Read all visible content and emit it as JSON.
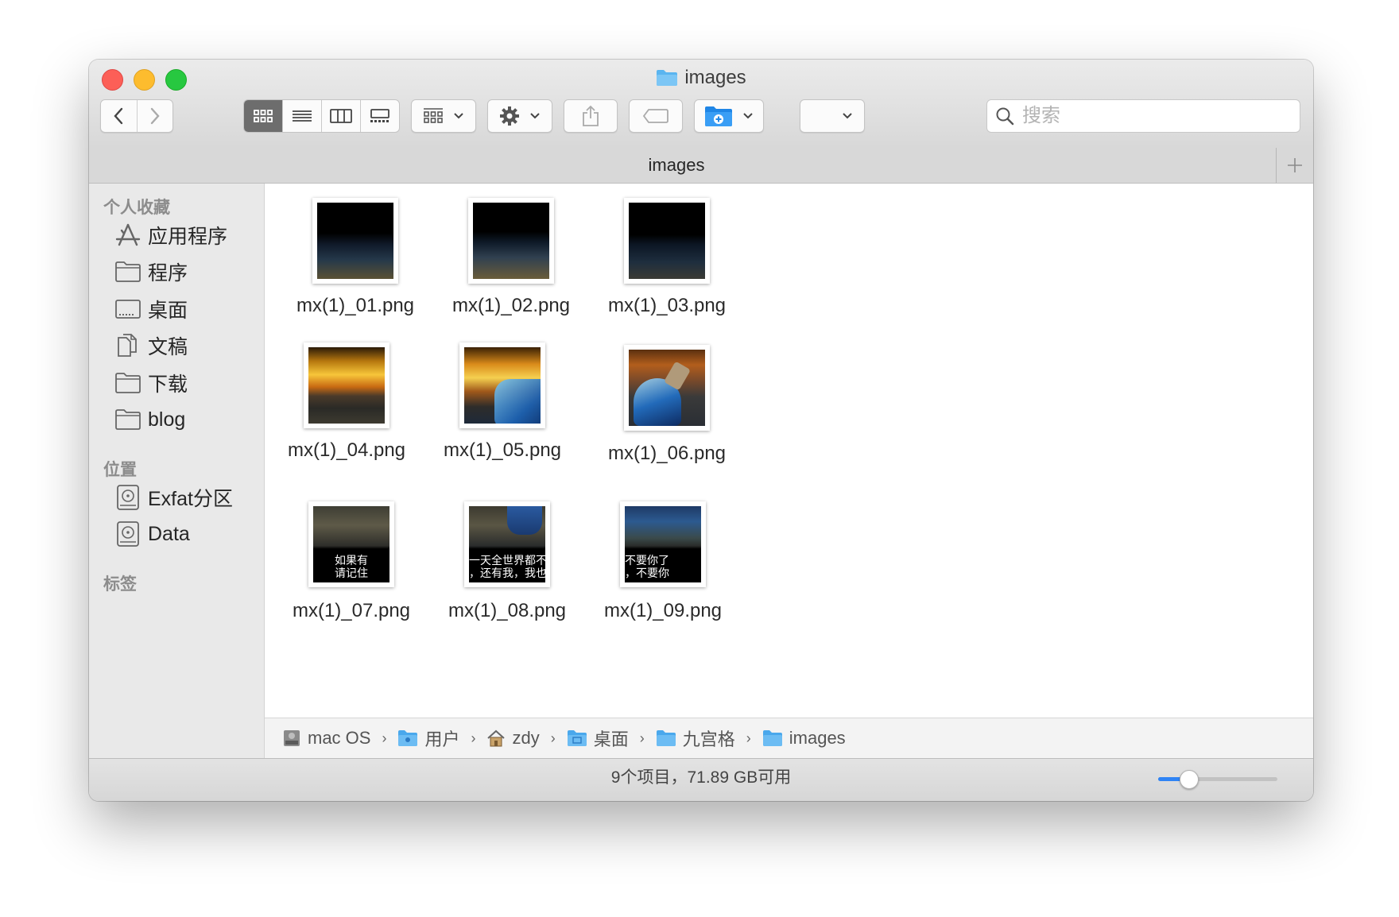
{
  "window": {
    "title": "images"
  },
  "toolbar": {
    "view_modes": [
      "icon-view",
      "list-view",
      "column-view",
      "gallery-view"
    ],
    "selected_view": "icon-view",
    "search_placeholder": "搜索"
  },
  "tabbar": {
    "title": "images"
  },
  "sidebar": {
    "sections": [
      {
        "heading": "个人收藏",
        "items": [
          {
            "label": "应用程序",
            "icon": "applications-icon"
          },
          {
            "label": "程序",
            "icon": "folder-icon"
          },
          {
            "label": "桌面",
            "icon": "desktop-icon"
          },
          {
            "label": "文稿",
            "icon": "documents-icon"
          },
          {
            "label": "下载",
            "icon": "folder-icon"
          },
          {
            "label": "blog",
            "icon": "folder-icon"
          }
        ]
      },
      {
        "heading": "位置",
        "items": [
          {
            "label": "Exfat分区",
            "icon": "disk-icon"
          },
          {
            "label": "Data",
            "icon": "disk-icon"
          }
        ]
      },
      {
        "heading": "标签",
        "items": []
      }
    ]
  },
  "files": [
    {
      "name": "mx(1)_01.png",
      "caption": []
    },
    {
      "name": "mx(1)_02.png",
      "caption": []
    },
    {
      "name": "mx(1)_03.png",
      "caption": []
    },
    {
      "name": "mx(1)_04.png",
      "caption": []
    },
    {
      "name": "mx(1)_05.png",
      "caption": []
    },
    {
      "name": "mx(1)_06.png",
      "caption": []
    },
    {
      "name": "mx(1)_07.png",
      "caption": [
        "如果有",
        "请记住"
      ]
    },
    {
      "name": "mx(1)_08.png",
      "caption": [
        "一天全世界都不",
        "，还有我，我也"
      ]
    },
    {
      "name": "mx(1)_09.png",
      "caption": [
        "不要你了",
        "，不要你"
      ]
    }
  ],
  "pathbar": [
    {
      "label": "mac OS",
      "icon": "hard-drive-icon"
    },
    {
      "label": "用户",
      "icon": "users-folder-icon"
    },
    {
      "label": "zdy",
      "icon": "home-icon"
    },
    {
      "label": "桌面",
      "icon": "desktop-folder-icon"
    },
    {
      "label": "九宫格",
      "icon": "folder-icon"
    },
    {
      "label": "images",
      "icon": "folder-icon"
    }
  ],
  "status": {
    "text": "9个项目，71.89 GB可用",
    "icon_size_fraction": 0.25
  },
  "colors": {
    "accent": "#2f84f5",
    "folder": "#5ab5f0"
  }
}
